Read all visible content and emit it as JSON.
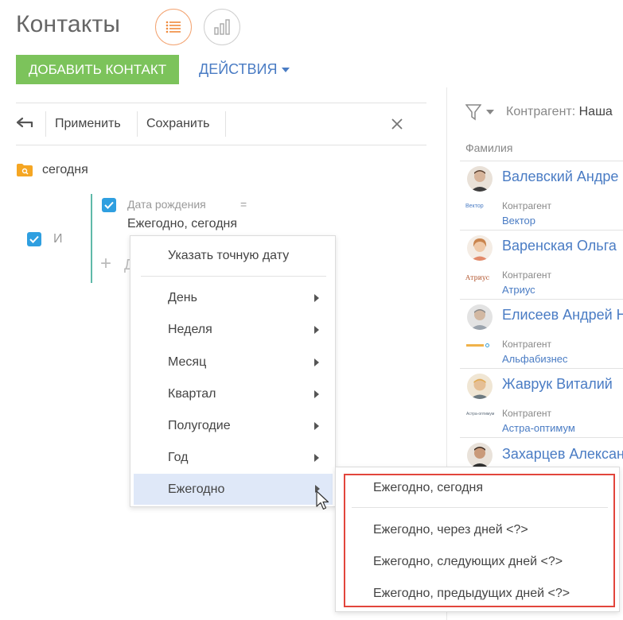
{
  "header": {
    "title": "Контакты",
    "add_button": "ДОБАВИТЬ КОНТАКТ",
    "actions_button": "ДЕЙСТВИЯ"
  },
  "filter_toolbar": {
    "apply": "Применить",
    "save": "Сохранить"
  },
  "filter": {
    "folder_label": "сегодня",
    "group_operator": "И",
    "condition_field": "Дата рождения",
    "condition_operator": "=",
    "condition_value": "Ежегодно, сегодня",
    "add_condition_partial": "Д"
  },
  "date_menu": {
    "exact_date": "Указать точную дату",
    "items": [
      {
        "label": "День"
      },
      {
        "label": "Неделя"
      },
      {
        "label": "Месяц"
      },
      {
        "label": "Квартал"
      },
      {
        "label": "Полугодие"
      },
      {
        "label": "Год"
      },
      {
        "label": "Ежегодно"
      }
    ],
    "highlighted": "Ежегодно"
  },
  "submenu": {
    "items": [
      {
        "label": "Ежегодно, сегодня"
      },
      {
        "label": "Ежегодно, через дней <?>"
      },
      {
        "label": "Ежегодно, следующих дней <?>"
      },
      {
        "label": "Ежегодно, предыдущих дней <?>"
      }
    ]
  },
  "right_panel": {
    "filter_label": "Контрагент:",
    "filter_value": "Наша",
    "column_header": "Фамилия",
    "field_label": "Контрагент",
    "contacts": [
      {
        "name": "Валевский Андре",
        "account": "Вектор",
        "logo_text": "Вектор"
      },
      {
        "name": "Варенская Ольга",
        "account": "Атриус",
        "logo_text": "Атриус"
      },
      {
        "name": "Елисеев Андрей Н",
        "account": "Альфабизнес",
        "logo_text": ""
      },
      {
        "name": "Жаврук Виталий",
        "account": "Астра-оптимум",
        "logo_text": "Астра-оптимум"
      },
      {
        "name": "Захарцев Алексан",
        "account": "",
        "logo_text": ""
      }
    ]
  },
  "colors": {
    "accent_green": "#7cc35b",
    "link_blue": "#4a7cc4",
    "checkbox_blue": "#2f9fe0",
    "highlight_red": "#e2453c",
    "active_view_orange": "#f3a472",
    "condition_bar_teal": "#5fb9a9",
    "folder_orange": "#f5a623"
  }
}
